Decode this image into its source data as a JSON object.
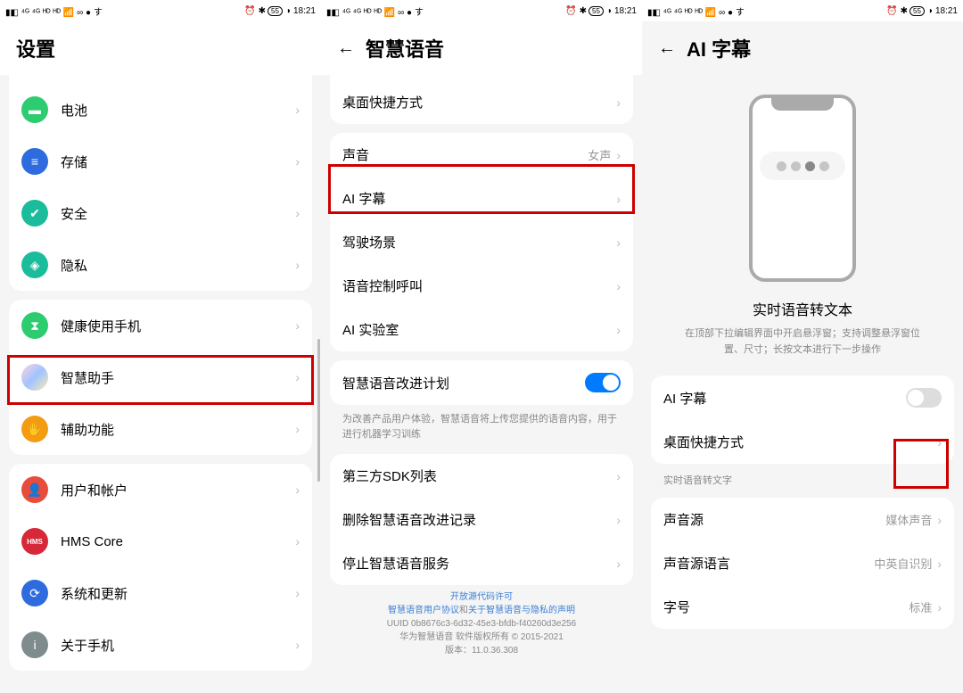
{
  "status": {
    "time": "18:21",
    "battery": "55"
  },
  "screen1": {
    "title": "设置",
    "g1": [
      {
        "icon": "ic-battery",
        "glyph": "▬",
        "label": "电池"
      },
      {
        "icon": "ic-storage",
        "glyph": "≡",
        "label": "存储"
      },
      {
        "icon": "ic-security",
        "glyph": "✔",
        "label": "安全"
      },
      {
        "icon": "ic-privacy",
        "glyph": "◈",
        "label": "隐私"
      }
    ],
    "g2": [
      {
        "icon": "ic-health",
        "glyph": "⧗",
        "label": "健康使用手机"
      },
      {
        "icon": "ic-smart",
        "glyph": "",
        "label": "智慧助手"
      },
      {
        "icon": "ic-access",
        "glyph": "✋",
        "label": "辅助功能"
      }
    ],
    "g3": [
      {
        "icon": "ic-user",
        "glyph": "👤",
        "label": "用户和帐户"
      },
      {
        "icon": "ic-hms",
        "glyph": "HMS",
        "label": "HMS Core"
      },
      {
        "icon": "ic-system",
        "glyph": "⟳",
        "label": "系统和更新"
      },
      {
        "icon": "ic-about",
        "glyph": "i",
        "label": "关于手机"
      }
    ]
  },
  "screen2": {
    "title": "智慧语音",
    "g1": [
      {
        "label": "桌面快捷方式",
        "value": ""
      },
      {
        "label": "声音",
        "value": "女声"
      },
      {
        "label": "AI 字幕",
        "value": ""
      },
      {
        "label": "驾驶场景",
        "value": ""
      },
      {
        "label": "语音控制呼叫",
        "value": ""
      },
      {
        "label": "AI 实验室",
        "value": ""
      }
    ],
    "plan_label": "智慧语音改进计划",
    "plan_desc": "为改善产品用户体验，智慧语音将上传您提供的语音内容，用于进行机器学习训练",
    "g3": [
      {
        "label": "第三方SDK列表"
      },
      {
        "label": "删除智慧语音改进记录"
      },
      {
        "label": "停止智慧语音服务"
      }
    ],
    "footer": {
      "l1": "开放源代码许可",
      "l2a": "智慧语音用户协议",
      "l2m": "和",
      "l2b": "关于智慧语音与隐私的声明",
      "l3": "UUID 0b8676c3-6d32-45e3-bfdb-f40260d3e256",
      "l4": "华为智慧语音 软件版权所有 © 2015-2021",
      "l5": "版本：11.0.36.308"
    }
  },
  "screen3": {
    "title": "AI 字幕",
    "illus_title": "实时语音转文本",
    "illus_desc": "在顶部下拉编辑界面中开启悬浮窗；支持调整悬浮窗位置、尺寸；长按文本进行下一步操作",
    "g1": [
      {
        "label": "AI 字幕",
        "toggle": true
      },
      {
        "label": "桌面快捷方式",
        "chev": true
      }
    ],
    "section": "实时语音转文字",
    "g2": [
      {
        "label": "声音源",
        "value": "媒体声音"
      },
      {
        "label": "声音源语言",
        "value": "中英自识别"
      },
      {
        "label": "字号",
        "value": "标准"
      }
    ]
  }
}
